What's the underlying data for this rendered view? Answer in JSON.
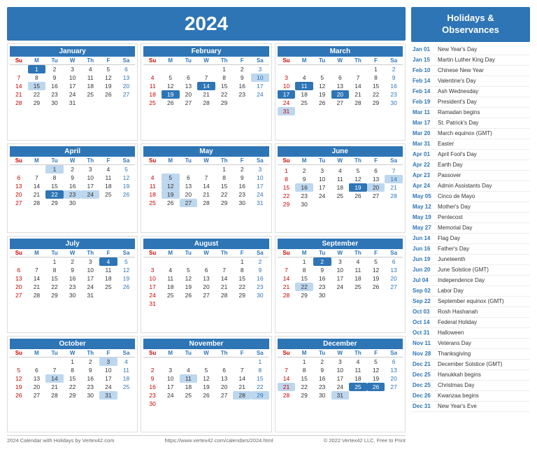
{
  "header": {
    "year": "2024"
  },
  "sidebar": {
    "title": "Holidays &\nObservances"
  },
  "months": [
    {
      "name": "January",
      "startDay": 1,
      "days": 31,
      "highlights": {
        "1": "today",
        "15": "holiday",
        "20": "saturday"
      }
    },
    {
      "name": "February",
      "startDay": 4,
      "days": 29,
      "highlights": {
        "10": "holiday",
        "14": "today",
        "19": "today"
      }
    },
    {
      "name": "March",
      "startDay": 5,
      "days": 31,
      "highlights": {
        "11": "holiday",
        "17": "holiday",
        "20": "holiday",
        "31": "holiday"
      }
    },
    {
      "name": "April",
      "startDay": 2,
      "days": 30,
      "highlights": {
        "1": "holiday",
        "22": "today",
        "23": "holiday",
        "24": "holiday"
      }
    },
    {
      "name": "May",
      "startDay": 4,
      "days": 31,
      "highlights": {
        "5": "holiday",
        "12": "holiday",
        "19": "holiday",
        "27": "holiday"
      }
    },
    {
      "name": "June",
      "startDay": 7,
      "days": 30,
      "highlights": {
        "14": "holiday",
        "16": "holiday",
        "19": "today",
        "20": "holiday"
      }
    },
    {
      "name": "July",
      "startDay": 2,
      "days": 31,
      "highlights": {
        "4": "holiday"
      }
    },
    {
      "name": "August",
      "startDay": 5,
      "days": 31,
      "highlights": {}
    },
    {
      "name": "September",
      "startDay": 1,
      "days": 30,
      "highlights": {
        "2": "today",
        "22": "holiday"
      }
    },
    {
      "name": "October",
      "startDay": 3,
      "days": 31,
      "highlights": {
        "3": "holiday",
        "14": "holiday",
        "31": "holiday"
      }
    },
    {
      "name": "November",
      "startDay": 6,
      "days": 30,
      "highlights": {
        "11": "holiday",
        "28": "holiday",
        "29": "today"
      }
    },
    {
      "name": "December",
      "startDay": 1,
      "days": 31,
      "highlights": {
        "21": "holiday",
        "25": "today",
        "26": "holiday",
        "31": "holiday"
      }
    }
  ],
  "holidays": [
    {
      "date": "Jan 01",
      "name": "New Year's Day"
    },
    {
      "date": "Jan 15",
      "name": "Martin Luther King Day"
    },
    {
      "date": "Feb 10",
      "name": "Chinese New Year"
    },
    {
      "date": "Feb 14",
      "name": "Valentine's Day"
    },
    {
      "date": "Feb 14",
      "name": "Ash Wednesday"
    },
    {
      "date": "Feb 19",
      "name": "President's Day"
    },
    {
      "date": "Mar 11",
      "name": "Ramadan begins"
    },
    {
      "date": "Mar 17",
      "name": "St. Patrick's Day"
    },
    {
      "date": "Mar 20",
      "name": "March equinox (GMT)"
    },
    {
      "date": "Mar 31",
      "name": "Easter"
    },
    {
      "date": "Apr 01",
      "name": "April Fool's Day"
    },
    {
      "date": "Apr 22",
      "name": "Earth Day"
    },
    {
      "date": "Apr 23",
      "name": "Passover"
    },
    {
      "date": "Apr 24",
      "name": "Admin Assistants Day"
    },
    {
      "date": "May 05",
      "name": "Cinco de Mayo"
    },
    {
      "date": "May 12",
      "name": "Mother's Day"
    },
    {
      "date": "May 19",
      "name": "Pentecost"
    },
    {
      "date": "May 27",
      "name": "Memorial Day"
    },
    {
      "date": "Jun 14",
      "name": "Flag Day"
    },
    {
      "date": "Jun 16",
      "name": "Father's Day"
    },
    {
      "date": "Jun 19",
      "name": "Juneteenth"
    },
    {
      "date": "Jun 20",
      "name": "June Solstice (GMT)"
    },
    {
      "date": "Jul 04",
      "name": "Independence Day"
    },
    {
      "date": "Sep 02",
      "name": "Labor Day"
    },
    {
      "date": "Sep 22",
      "name": "September equinox (GMT)"
    },
    {
      "date": "Oct 03",
      "name": "Rosh Hashanah"
    },
    {
      "date": "Oct 14",
      "name": "Federal Holiday"
    },
    {
      "date": "Oct 31",
      "name": "Halloween"
    },
    {
      "date": "Nov 11",
      "name": "Veterans Day"
    },
    {
      "date": "Nov 28",
      "name": "Thanksgiving"
    },
    {
      "date": "Dec 21",
      "name": "December Solstice (GMT)"
    },
    {
      "date": "Dec 25",
      "name": "Hanukkah begins"
    },
    {
      "date": "Dec 25",
      "name": "Christmas Day"
    },
    {
      "date": "Dec 26",
      "name": "Kwanzaa begins"
    },
    {
      "date": "Dec 31",
      "name": "New Year's Eve"
    }
  ],
  "footer": {
    "left": "2024 Calendar with Holidays by Vertex42.com",
    "center": "https://www.vertex42.com/calendars/2024.html",
    "right": "© 2022 Vertex42 LLC. Free to Print"
  }
}
